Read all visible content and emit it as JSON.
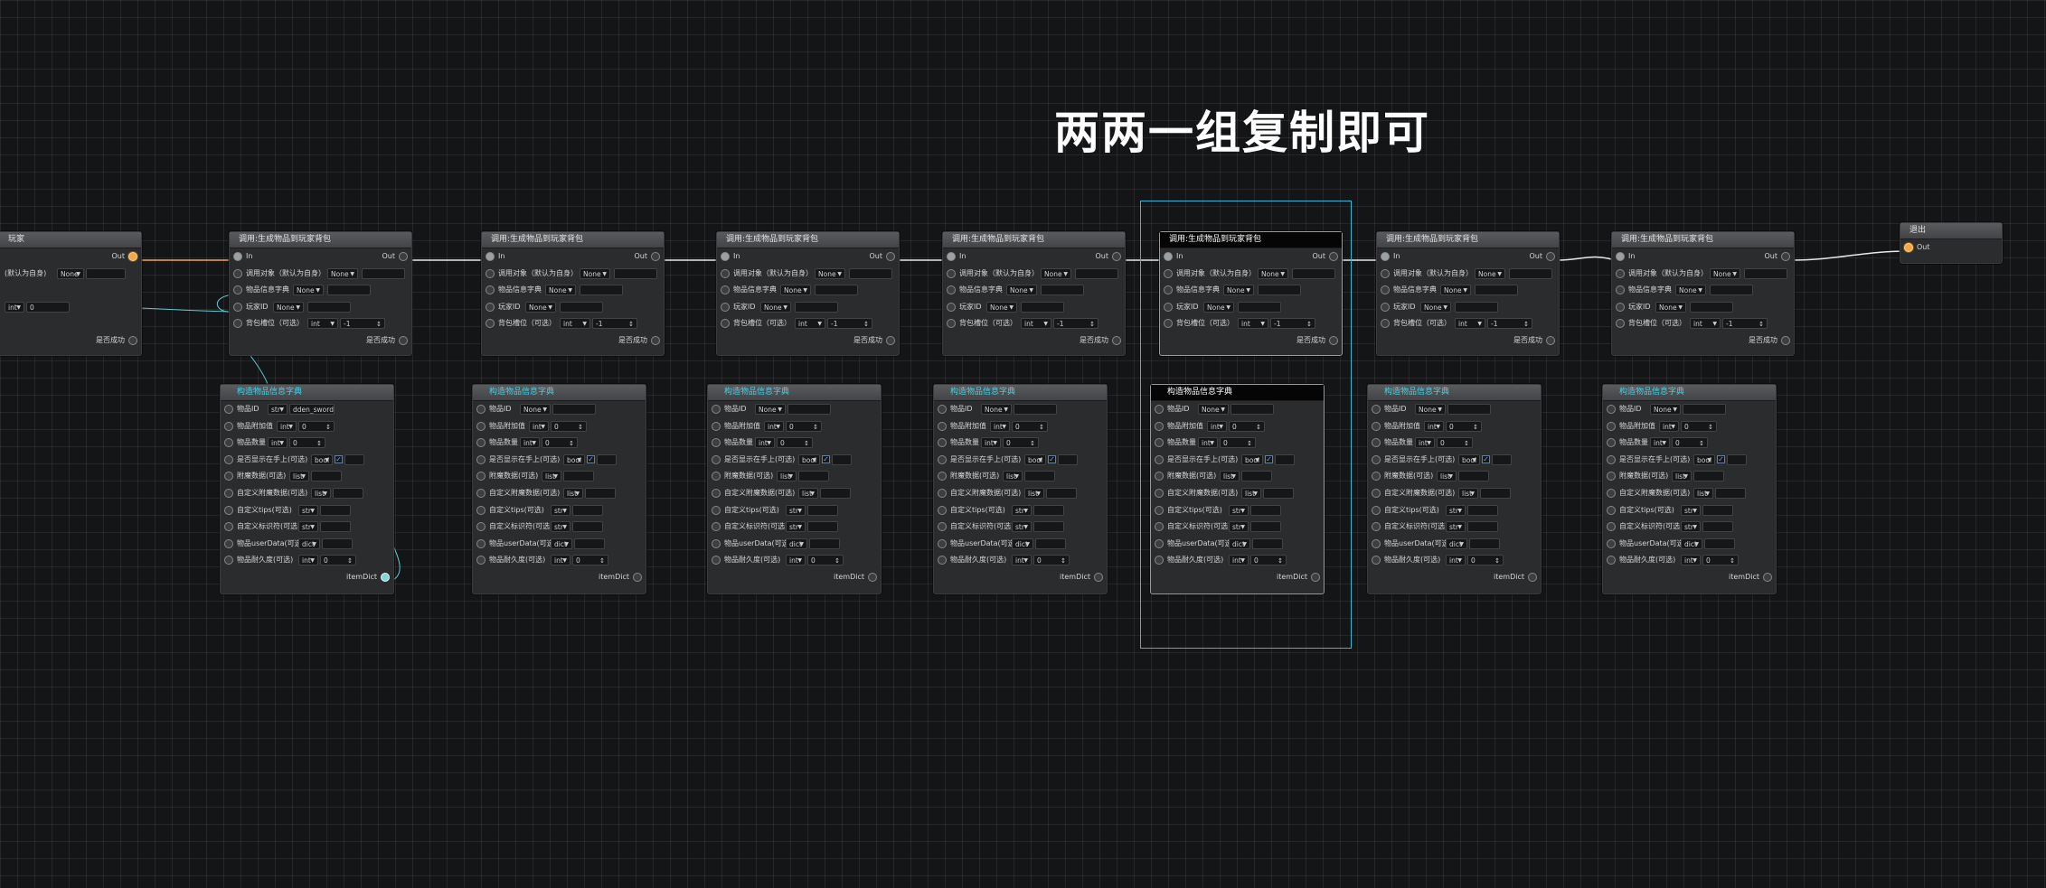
{
  "banner": "两两一组复制即可",
  "dropdown_none": "None",
  "labels": {
    "in": "In",
    "out": "Out",
    "caller": "调用对象（默认为自身）",
    "item_info_dict": "物品信息字典",
    "player_id": "玩家ID",
    "bag_slot": "背包槽位（可选）",
    "success": "是否成功",
    "item_dict": "itemDict",
    "item_id": "物品ID",
    "item_bonus": "物品附加值",
    "item_count": "物品数量",
    "show_in_hand": "是否显示在手上(可选)",
    "extra_data": "附魔数据(可选)",
    "custom_enchant": "自定义附魔数据(可选)",
    "custom_tips": "自定义tips(可选)",
    "custom_tag": "自定义标识符(可选)",
    "user_data": "物品userData(可选)",
    "durability": "物品耐久度(可选)"
  },
  "types": {
    "int": "int",
    "str": "str",
    "bool": "bool",
    "list": "list",
    "dict": "dict"
  },
  "values": {
    "zero": "0",
    "neg_one": "-1",
    "sword": "dden_sword",
    "check": "✓"
  },
  "partial_node": {
    "title_fragment": "玩家",
    "caller_fragment": "(默认为自身)"
  },
  "call_node_title": "调用:生成物品到玩家背包",
  "build_node_title": "构造物品信息字典",
  "exit_node_title": "退出"
}
